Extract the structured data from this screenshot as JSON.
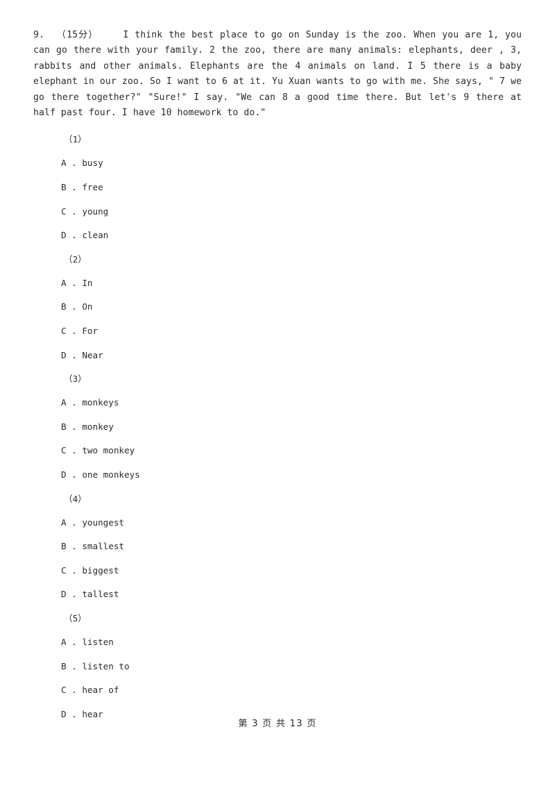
{
  "document": {
    "type": "exam-worksheet",
    "background_color": "#ffffff",
    "text_color": "#2b2b2b"
  },
  "question": {
    "number": "9.",
    "score": "（15分）",
    "passage": "I think the best place to go on Sunday is the zoo. When you are 1, you can go there with your family.  2 the zoo, there are many animals: elephants, deer , 3, rabbits and other animals. Elephants are the 4 animals on land. I 5 there is a baby elephant in our zoo. So I want to 6 at it. Yu Xuan wants to go with me. She says, \" 7 we go there together?\" \"Sure!\" I say. \"We can 8 a good time there. But let's 9 there at half past four. I have 10 homework to do.\""
  },
  "subquestions": [
    {
      "label": "（1）",
      "options": [
        {
          "letter": "A",
          "dot": " . ",
          "text": "busy"
        },
        {
          "letter": "B",
          "dot": " . ",
          "text": "free"
        },
        {
          "letter": "C",
          "dot": " . ",
          "text": "young"
        },
        {
          "letter": "D",
          "dot": " . ",
          "text": "clean"
        }
      ]
    },
    {
      "label": "（2）",
      "options": [
        {
          "letter": "A",
          "dot": " . ",
          "text": "In"
        },
        {
          "letter": "B",
          "dot": " . ",
          "text": "On"
        },
        {
          "letter": "C",
          "dot": " . ",
          "text": "For"
        },
        {
          "letter": "D",
          "dot": " . ",
          "text": "Near"
        }
      ]
    },
    {
      "label": "（3）",
      "options": [
        {
          "letter": "A",
          "dot": " . ",
          "text": "monkeys"
        },
        {
          "letter": "B",
          "dot": " . ",
          "text": "monkey"
        },
        {
          "letter": "C",
          "dot": " . ",
          "text": "two monkey"
        },
        {
          "letter": "D",
          "dot": " . ",
          "text": "one monkeys"
        }
      ]
    },
    {
      "label": "（4）",
      "options": [
        {
          "letter": "A",
          "dot": " . ",
          "text": "youngest"
        },
        {
          "letter": "B",
          "dot": " . ",
          "text": "smallest"
        },
        {
          "letter": "C",
          "dot": " . ",
          "text": "biggest"
        },
        {
          "letter": "D",
          "dot": " . ",
          "text": "tallest"
        }
      ]
    },
    {
      "label": "（5）",
      "options": [
        {
          "letter": "A",
          "dot": " . ",
          "text": "listen"
        },
        {
          "letter": "B",
          "dot": " . ",
          "text": "listen to"
        },
        {
          "letter": "C",
          "dot": " . ",
          "text": "hear of"
        },
        {
          "letter": "D",
          "dot": " . ",
          "text": "hear"
        }
      ]
    }
  ],
  "footer": {
    "text": "第 3 页 共 13 页",
    "current_page": "3",
    "total_pages": "13"
  }
}
